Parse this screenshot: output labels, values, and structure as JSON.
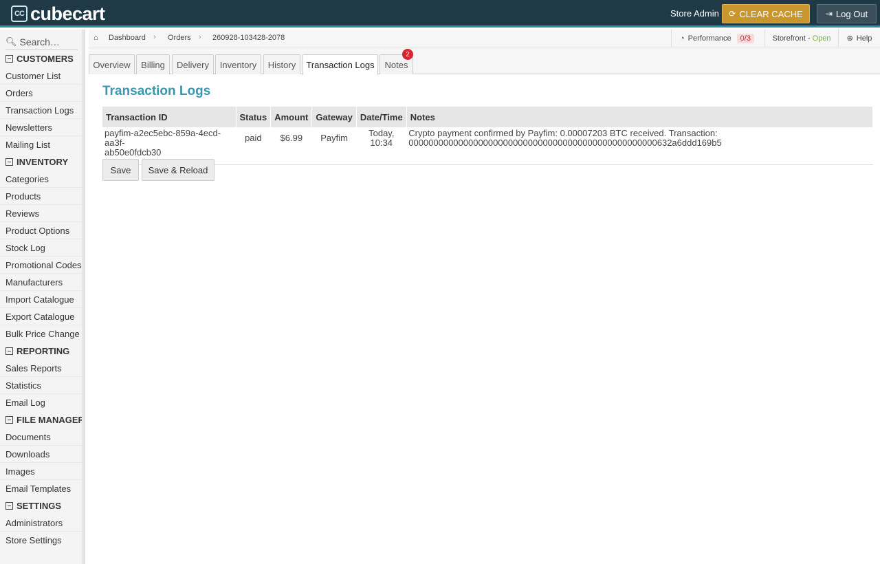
{
  "header": {
    "logo_text": "cubecart",
    "logo_badge": "CC",
    "store_admin": "Store Admin",
    "clear_cache": "CLEAR CACHE",
    "log_out": "Log Out"
  },
  "sidebar": {
    "search_placeholder": "Search…",
    "sections": [
      {
        "title": "CUSTOMERS",
        "items": [
          "Customer List",
          "Orders",
          "Transaction Logs",
          "Newsletters",
          "Mailing List"
        ]
      },
      {
        "title": "INVENTORY",
        "items": [
          "Categories",
          "Products",
          "Reviews",
          "Product Options",
          "Stock Log",
          "Promotional Codes",
          "Manufacturers",
          "Import Catalogue",
          "Export Catalogue",
          "Bulk Price Change"
        ]
      },
      {
        "title": "REPORTING",
        "items": [
          "Sales Reports",
          "Statistics",
          "Email Log"
        ]
      },
      {
        "title": "FILE MANAGER",
        "items": [
          "Documents",
          "Downloads",
          "Images",
          "Email Templates"
        ]
      },
      {
        "title": "SETTINGS",
        "items": [
          "Administrators",
          "Store Settings"
        ]
      }
    ]
  },
  "breadcrumb": {
    "items": [
      "Dashboard",
      "Orders",
      "260928-103428-2078"
    ],
    "performance_label": "Performance",
    "performance_value": "0/3",
    "storefront_label": "Storefront -",
    "storefront_status": "Open",
    "help": "Help"
  },
  "tabs": [
    {
      "label": "Overview"
    },
    {
      "label": "Billing"
    },
    {
      "label": "Delivery"
    },
    {
      "label": "Inventory"
    },
    {
      "label": "History"
    },
    {
      "label": "Transaction Logs",
      "active": true
    },
    {
      "label": "Notes",
      "badge": "2"
    }
  ],
  "main": {
    "title": "Transaction Logs",
    "columns": [
      "Transaction ID",
      "Status",
      "Amount",
      "Gateway",
      "Date/Time",
      "Notes"
    ],
    "rows": [
      {
        "transaction_id_line1": "payfim-a2ec5ebc-859a-4ecd-aa3f-",
        "transaction_id_line2": "ab50e0fdcb30",
        "status": "paid",
        "amount": "$6.99",
        "gateway": "Payfim",
        "date_line1": "Today,",
        "date_line2": "10:34",
        "notes_line1": "Crypto payment confirmed by Payfim: 0.00007203 BTC received. Transaction:",
        "notes_line2": "00000000000000000000000000000000000000000000000000632a6ddd169b5"
      }
    ],
    "save": "Save",
    "save_reload": "Save & Reload"
  }
}
